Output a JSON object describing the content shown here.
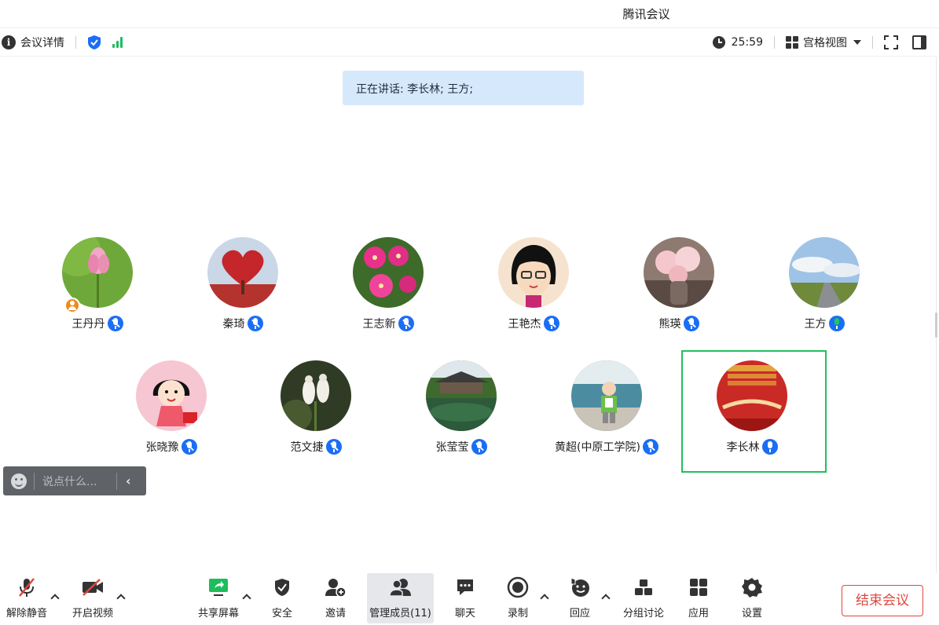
{
  "window": {
    "title": "腾讯会议"
  },
  "infobar": {
    "details_label": "会议详情",
    "timer": "25:59",
    "view_label": "宫格视图"
  },
  "speaking": {
    "text": "正在讲话: 李长林; 王方;"
  },
  "participants": [
    {
      "name": "王丹丹",
      "mic": "muted",
      "host": true
    },
    {
      "name": "秦琦",
      "mic": "muted"
    },
    {
      "name": "王志新",
      "mic": "muted"
    },
    {
      "name": "王艳杰",
      "mic": "muted"
    },
    {
      "name": "熊瑛",
      "mic": "muted"
    },
    {
      "name": "王方",
      "mic": "speaking"
    },
    {
      "name": "张晓豫",
      "mic": "muted"
    },
    {
      "name": "范文捷",
      "mic": "muted"
    },
    {
      "name": "张莹莹",
      "mic": "muted"
    },
    {
      "name": "黄超(中原工学院)",
      "mic": "muted"
    },
    {
      "name": "李长林",
      "mic": "on",
      "active": true
    }
  ],
  "chat": {
    "placeholder": "说点什么..."
  },
  "toolbar": {
    "unmute": "解除静音",
    "start_video": "开启视频",
    "share": "共享屏幕",
    "security": "安全",
    "invite": "邀请",
    "manage": "管理成员(11)",
    "chat": "聊天",
    "record": "录制",
    "react": "回应",
    "breakout": "分组讨论",
    "apps": "应用",
    "settings": "设置",
    "end": "结束会议"
  },
  "colors": {
    "accent": "#1a6ef5",
    "active_border": "#21c05c",
    "end_red": "#e0463e",
    "speaking_bg": "#d6e8fc"
  }
}
